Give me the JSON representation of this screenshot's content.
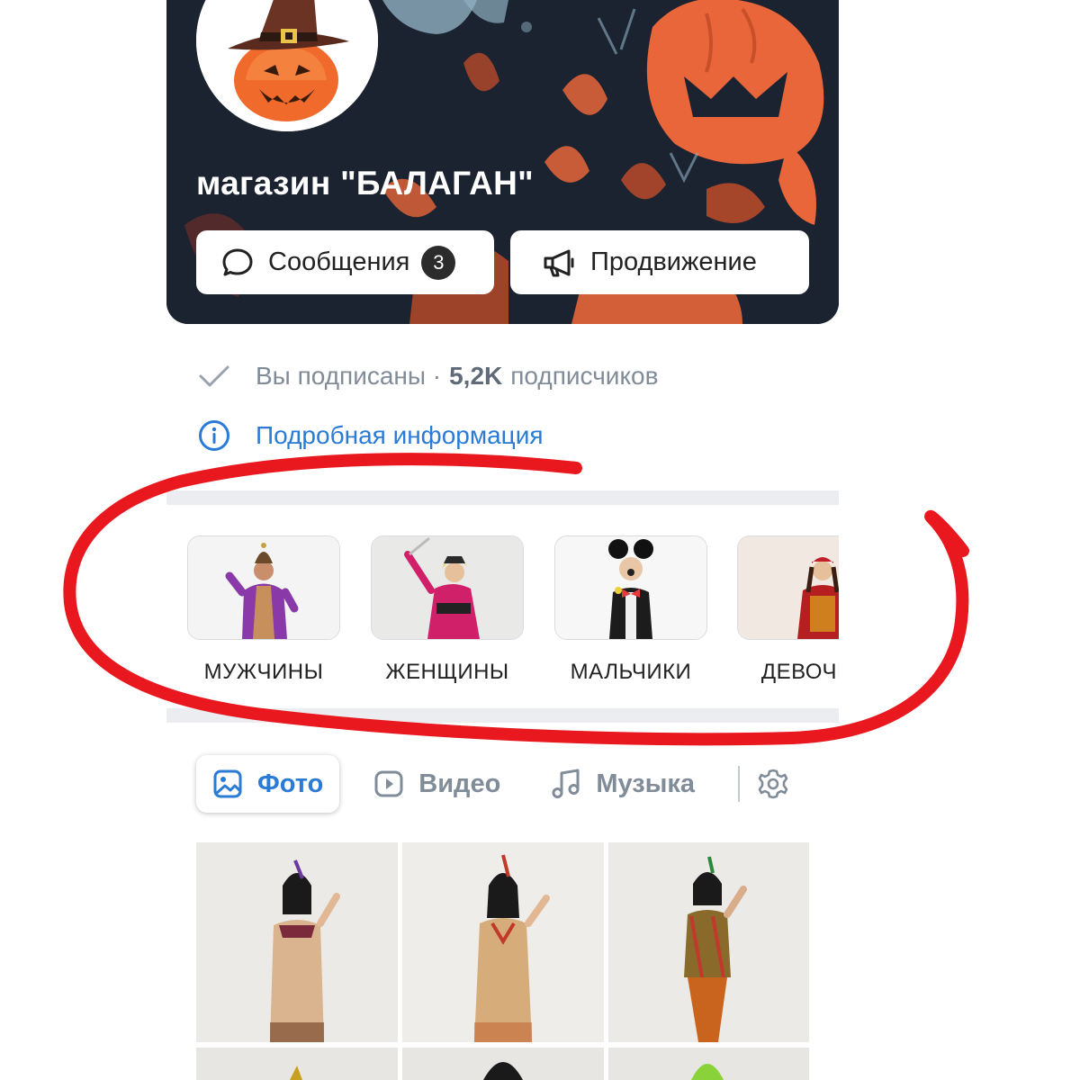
{
  "group": {
    "name": "магазин \"БАЛАГАН\"",
    "messages_label": "Сообщения",
    "messages_count": "3",
    "promotion_label": "Продвижение",
    "subscribed_text": "Вы подписаны ·",
    "subscribers_count": "5,2K",
    "subscribers_label": "подписчиков",
    "more_info_label": "Подробная информация"
  },
  "categories": [
    {
      "label": "МУЖЧИНЫ"
    },
    {
      "label": "ЖЕНЩИНЫ"
    },
    {
      "label": "МАЛЬЧИКИ"
    },
    {
      "label": "ДЕВОЧКИ"
    }
  ],
  "tabs": {
    "photo": "Фото",
    "video": "Видео",
    "music": "Музыка"
  },
  "colors": {
    "accent": "#2a7bd6",
    "annotation": "#e8181e",
    "cover_bg": "#1b2230",
    "pumpkin": "#f06a2c"
  }
}
